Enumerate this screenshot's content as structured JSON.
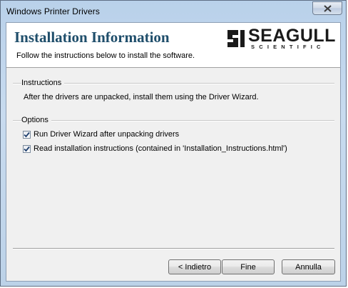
{
  "window": {
    "title": "Windows Printer Drivers"
  },
  "header": {
    "heading": "Installation Information",
    "subheading": "Follow the instructions below to install the software.",
    "logo": {
      "word": "SEAGULL",
      "sub": "SCIENTIFIC",
      "color": "#1a1a1a"
    }
  },
  "instructions": {
    "label": "Instructions",
    "text": "After the drivers are unpacked, install them using the Driver Wizard."
  },
  "options": {
    "label": "Options",
    "items": [
      {
        "label": "Run Driver Wizard after unpacking drivers",
        "checked": true
      },
      {
        "label": "Read installation instructions (contained in 'Installation_Instructions.html')",
        "checked": true
      }
    ]
  },
  "buttons": {
    "back": "< Indietro",
    "finish": "Fine",
    "cancel": "Annulla"
  },
  "colors": {
    "heading": "#1f4e6b",
    "title_bar": "#b9d1ea",
    "dialog_bg": "#f0f0f0"
  }
}
